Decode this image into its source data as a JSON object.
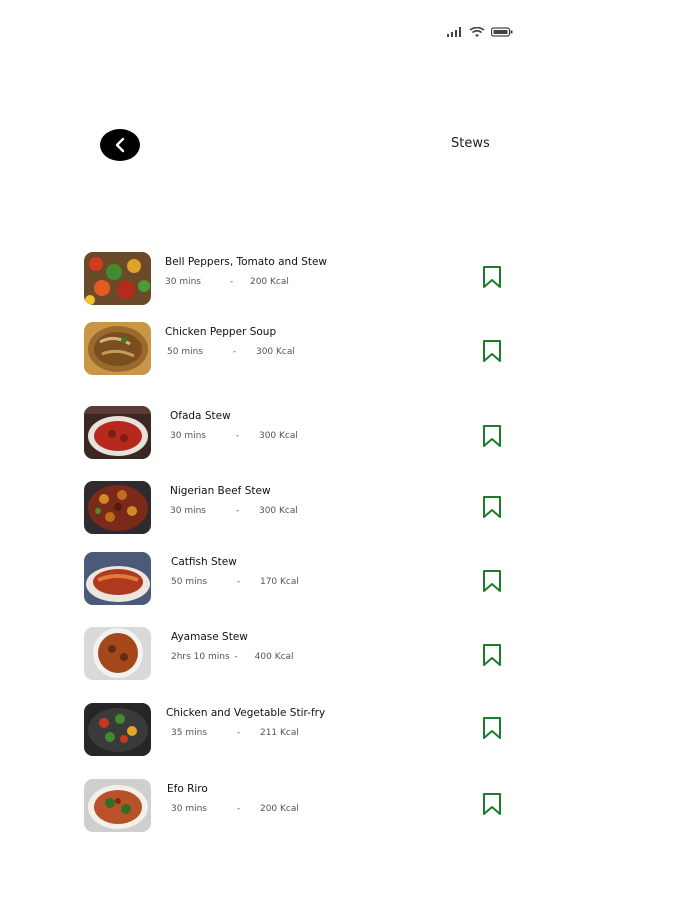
{
  "header": {
    "title": "Stews"
  },
  "colors": {
    "accent": "#1e7b2a",
    "back_button": "#000000"
  },
  "icons": {
    "back": "chevron-left-icon",
    "bookmark": "bookmark-icon",
    "signal": "signal-icon",
    "wifi": "wifi-icon",
    "battery": "battery-icon"
  },
  "recipes": [
    {
      "name": "Bell Peppers, Tomato and Stew",
      "time": "30 mins",
      "sep": "-",
      "kcal": "200 Kcal"
    },
    {
      "name": "Chicken Pepper Soup",
      "time": "50 mins",
      "sep": "-",
      "kcal": "300 Kcal"
    },
    {
      "name": "Ofada Stew",
      "time": "30 mins",
      "sep": "-",
      "kcal": "300 Kcal"
    },
    {
      "name": "Nigerian Beef Stew",
      "time": "30 mins",
      "sep": "-",
      "kcal": "300 Kcal"
    },
    {
      "name": "Catfish Stew",
      "time": "50 mins",
      "sep": "-",
      "kcal": "170 Kcal"
    },
    {
      "name": "Ayamase Stew",
      "time": "2hrs 10 mins",
      "sep": "-",
      "kcal": "400 Kcal"
    },
    {
      "name": "Chicken and Vegetable Stir-fry",
      "time": "35 mins",
      "sep": "-",
      "kcal": "211 Kcal"
    },
    {
      "name": "Efo Riro",
      "time": "30 mins",
      "sep": "-",
      "kcal": "200 Kcal"
    }
  ]
}
